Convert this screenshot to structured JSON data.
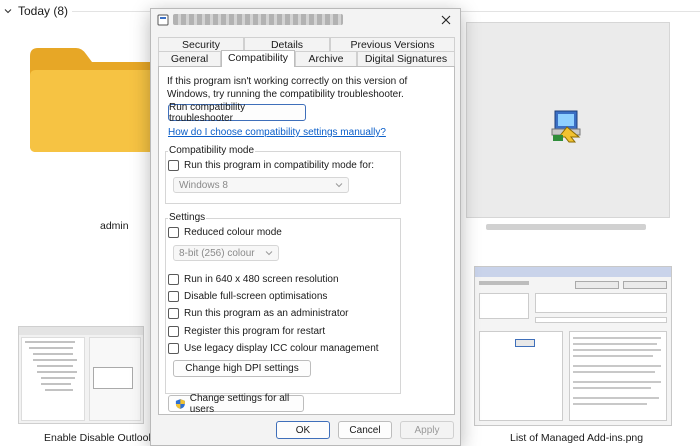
{
  "explorer": {
    "group_header": "Today (8)",
    "files": {
      "folder_label": "admin",
      "bottom_left_label": "Enable Disable Outlook Add",
      "bottom_right_label": "List of Managed Add-ins.png"
    }
  },
  "dialog": {
    "tabs": {
      "security": "Security",
      "details": "Details",
      "previous_versions": "Previous Versions",
      "general": "General",
      "compatibility": "Compatibility",
      "archive": "Archive",
      "digital_signatures": "Digital Signatures"
    },
    "intro_text": "If this program isn't working correctly on this version of Windows, try running the compatibility troubleshooter.",
    "troubleshooter_button": "Run compatibility troubleshooter",
    "help_link": "How do I choose compatibility settings manually?",
    "compat_mode": {
      "title": "Compatibility mode",
      "checkbox_label": "Run this program in compatibility mode for:",
      "select_value": "Windows 8"
    },
    "settings": {
      "title": "Settings",
      "reduced_colour": "Reduced colour mode",
      "colour_select_value": "8-bit (256) colour",
      "res_640": "Run in 640 x 480 screen resolution",
      "disable_fullscreen": "Disable full-screen optimisations",
      "run_as_admin": "Run this program as an administrator",
      "register_restart": "Register this program for restart",
      "legacy_icc": "Use legacy display ICC colour management",
      "high_dpi_button": "Change high DPI settings"
    },
    "all_users_button": "Change settings for all users",
    "footer": {
      "ok": "OK",
      "cancel": "Cancel",
      "apply": "Apply"
    }
  },
  "colors": {
    "link": "#0a5ec9",
    "primary_border": "#3f6fba",
    "folder": "#f6c343"
  }
}
